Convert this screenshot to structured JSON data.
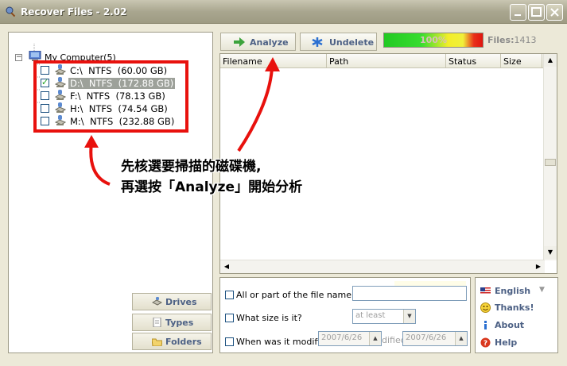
{
  "window": {
    "title": "Recover Files - 2.02"
  },
  "tree": {
    "root_label": "My Computer(5)",
    "expander": "−",
    "drives": [
      {
        "letter": "C:\\",
        "fs": "NTFS",
        "size": "(60.00 GB)",
        "checked": false
      },
      {
        "letter": "D:\\",
        "fs": "NTFS",
        "size": "(172.88 GB)",
        "checked": true
      },
      {
        "letter": "F:\\",
        "fs": "NTFS",
        "size": "(78.13 GB)",
        "checked": false
      },
      {
        "letter": "H:\\",
        "fs": "NTFS",
        "size": "(74.54 GB)",
        "checked": false
      },
      {
        "letter": "M:\\",
        "fs": "NTFS",
        "size": "(232.88 GB)",
        "checked": false
      }
    ]
  },
  "side_buttons": {
    "drives": "Drives",
    "types": "Types",
    "folders": "Folders"
  },
  "toolbar": {
    "analyze": "Analyze",
    "undelete": "Undelete",
    "progress_text": "100%",
    "progress": 1.0,
    "files_label": "Files:",
    "files_count": "1413"
  },
  "table": {
    "columns": [
      "Filename",
      "Path",
      "Status",
      "Size",
      ""
    ]
  },
  "filter": {
    "name_label": "All or part of the file name:",
    "size_label": "What size is it?",
    "size_option": "at least",
    "date_label": "When was it modified?",
    "date_from": "2007/6/26",
    "date_mid": "dified",
    "date_to": "2007/6/26"
  },
  "links": {
    "language": "English",
    "thanks": "Thanks!",
    "about": "About",
    "help": "Help"
  },
  "annotation": {
    "line1": "先核選要掃描的磁碟機,",
    "line2": "再選按「Analyze」開始分析"
  },
  "colors": {
    "accent_red": "#e8110d",
    "link_blue": "#4d6185"
  }
}
